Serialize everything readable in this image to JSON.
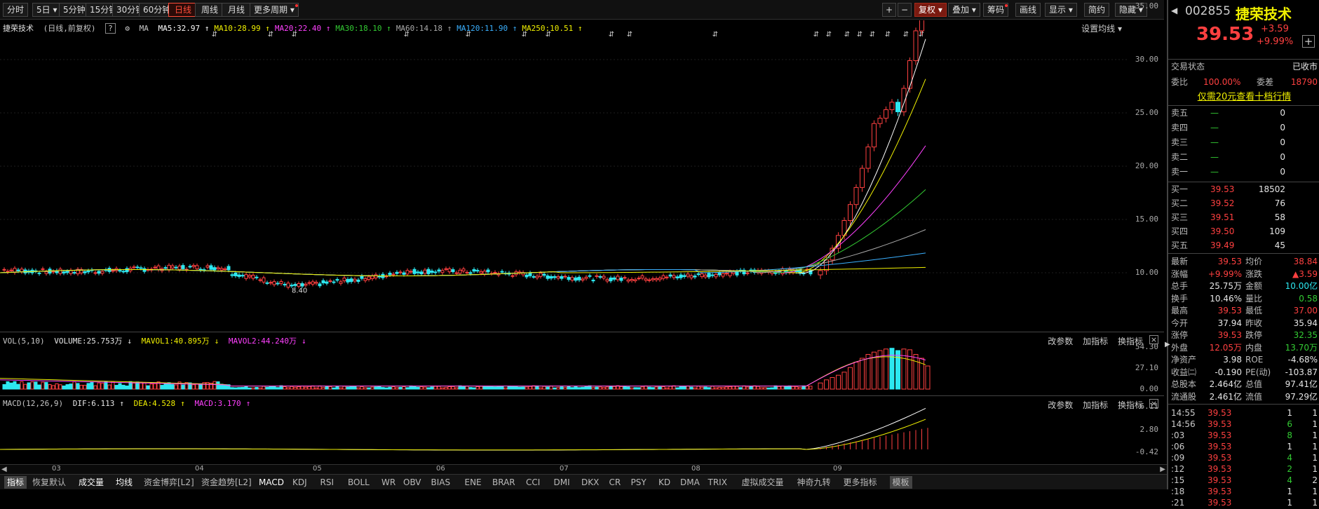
{
  "toolbar": {
    "periods": [
      "分时",
      "5日",
      "5分钟",
      "15分钟",
      "30分钟",
      "60分钟",
      "日线",
      "周线",
      "月线",
      "更多周期"
    ],
    "active_period": "日线",
    "right_buttons": [
      "+",
      "−",
      "复权",
      "叠加",
      "筹码",
      "画线",
      "显示",
      "简约",
      "隐藏"
    ]
  },
  "main_chart": {
    "title": "捷荣技术",
    "mode": "(日线,前复权)",
    "help": "?",
    "ma_label": "MA",
    "ma": [
      {
        "text": "MA5:32.97",
        "color": "#ffffff"
      },
      {
        "text": "MA10:28.99",
        "color": "#f0f000"
      },
      {
        "text": "MA20:22.40",
        "color": "#ff40ff"
      },
      {
        "text": "MA30:18.10",
        "color": "#33cc33"
      },
      {
        "text": "MA60:14.18",
        "color": "#aaaaaa"
      },
      {
        "text": "MA120:11.90",
        "color": "#3ab0ff"
      },
      {
        "text": "MA250:10.51",
        "color": "#f0f000"
      }
    ],
    "settings": "设置均线",
    "yticks": [
      "35.00",
      "30.00",
      "25.00",
      "20.00",
      "15.00",
      "10.00"
    ],
    "high_label": "39.53",
    "low_label": "8.40"
  },
  "vol_chart": {
    "label": "VOL(5,10)",
    "volume": "VOLUME:25.753万",
    "mavol1": "MAVOL1:40.895万",
    "mavol2": "MAVOL2:44.240万",
    "yticks": [
      "54.30",
      "27.10",
      "0.00"
    ],
    "tools": [
      "改参数",
      "加指标",
      "换指标"
    ]
  },
  "macd_chart": {
    "label": "MACD(12,26,9)",
    "dif": "DIF:6.113",
    "dea": "DEA:4.528",
    "macd": "MACD:3.170",
    "yticks": [
      "6.11",
      "2.80",
      "-0.42"
    ],
    "tools": [
      "改参数",
      "加指标",
      "换指标"
    ]
  },
  "xaxis": [
    "03",
    "04",
    "05",
    "06",
    "07",
    "08",
    "09"
  ],
  "quote": {
    "code": "002855",
    "name": "捷荣技术",
    "price": "39.53",
    "change": "+3.59",
    "pct": "+9.99%",
    "status_label": "交易状态",
    "status": "已收市",
    "weibi_label": "委比",
    "weibi": "100.00%",
    "weicha_label": "委差",
    "weicha": "18790",
    "promo": "仅需20元查看十档行情",
    "asks": [
      {
        "l": "卖五",
        "p": "—",
        "v": "0"
      },
      {
        "l": "卖四",
        "p": "—",
        "v": "0"
      },
      {
        "l": "卖三",
        "p": "—",
        "v": "0"
      },
      {
        "l": "卖二",
        "p": "—",
        "v": "0"
      },
      {
        "l": "卖一",
        "p": "—",
        "v": "0"
      }
    ],
    "bids": [
      {
        "l": "买一",
        "p": "39.53",
        "v": "18502"
      },
      {
        "l": "买二",
        "p": "39.52",
        "v": "76"
      },
      {
        "l": "买三",
        "p": "39.51",
        "v": "58"
      },
      {
        "l": "买四",
        "p": "39.50",
        "v": "109"
      },
      {
        "l": "买五",
        "p": "39.49",
        "v": "45"
      }
    ],
    "stats": [
      [
        "最新",
        "39.53",
        "均价",
        "38.84"
      ],
      [
        "涨幅",
        "+9.99%",
        "涨跌",
        "▲3.59"
      ],
      [
        "总手",
        "25.75万",
        "金额",
        "10.00亿"
      ],
      [
        "换手",
        "10.46%",
        "量比",
        "0.58"
      ],
      [
        "最高",
        "39.53",
        "最低",
        "37.00"
      ],
      [
        "今开",
        "37.94",
        "昨收",
        "35.94"
      ],
      [
        "涨停",
        "39.53",
        "跌停",
        "32.35"
      ],
      [
        "外盘",
        "12.05万",
        "内盘",
        "13.70万"
      ],
      [
        "净资产",
        "3.98",
        "ROE",
        "-4.68%"
      ],
      [
        "收益㈡",
        "-0.190",
        "PE(动)",
        "-103.87"
      ],
      [
        "总股本",
        "2.464亿",
        "总值",
        "97.41亿"
      ],
      [
        "流通股",
        "2.461亿",
        "流值",
        "97.29亿"
      ]
    ],
    "ticks": [
      {
        "t": "14:55",
        "p": "39.53",
        "v": "1",
        "n": "1"
      },
      {
        "t": "14:56",
        "p": "39.53",
        "v": "6",
        "n": "1"
      },
      {
        "t": ":03",
        "p": "39.53",
        "v": "8",
        "n": "1"
      },
      {
        "t": ":06",
        "p": "39.53",
        "v": "1",
        "n": "1"
      },
      {
        "t": ":09",
        "p": "39.53",
        "v": "4",
        "n": "1"
      },
      {
        "t": ":12",
        "p": "39.53",
        "v": "2",
        "n": "1"
      },
      {
        "t": ":15",
        "p": "39.53",
        "v": "4",
        "n": "2"
      },
      {
        "t": ":18",
        "p": "39.53",
        "v": "1",
        "n": "1"
      },
      {
        "t": ":21",
        "p": "39.53",
        "v": "1",
        "n": "1"
      }
    ]
  },
  "bottom_tabs": [
    "指标",
    "恢复默认",
    "成交量",
    "均线",
    "资金博弈[L2]",
    "资金趋势[L2]",
    "MACD",
    "KDJ",
    "RSI",
    "BOLL",
    "WR",
    "OBV",
    "BIAS",
    "ENE",
    "BRAR",
    "CCI",
    "DMI",
    "DKX",
    "CR",
    "PSY",
    "KD",
    "DMA",
    "TRIX",
    "虚拟成交量",
    "神奇九转",
    "更多指标",
    "模板"
  ],
  "chart_data": {
    "type": "candlestick",
    "x": [
      "03",
      "04",
      "05",
      "06",
      "07",
      "08",
      "09"
    ],
    "close_recent": [
      10.2,
      11.2,
      12.3,
      13.5,
      14.9,
      16.4,
      18.0,
      19.8,
      21.8,
      24.0,
      24.5,
      25.3,
      26.0,
      25.1,
      27.3,
      29.9,
      32.7,
      35.9,
      39.53
    ],
    "price_range": [
      8.4,
      39.53
    ],
    "ma": {
      "MA5": 32.97,
      "MA10": 28.99,
      "MA20": 22.4,
      "MA30": 18.1,
      "MA60": 14.18,
      "MA120": 11.9,
      "MA250": 10.51
    }
  }
}
